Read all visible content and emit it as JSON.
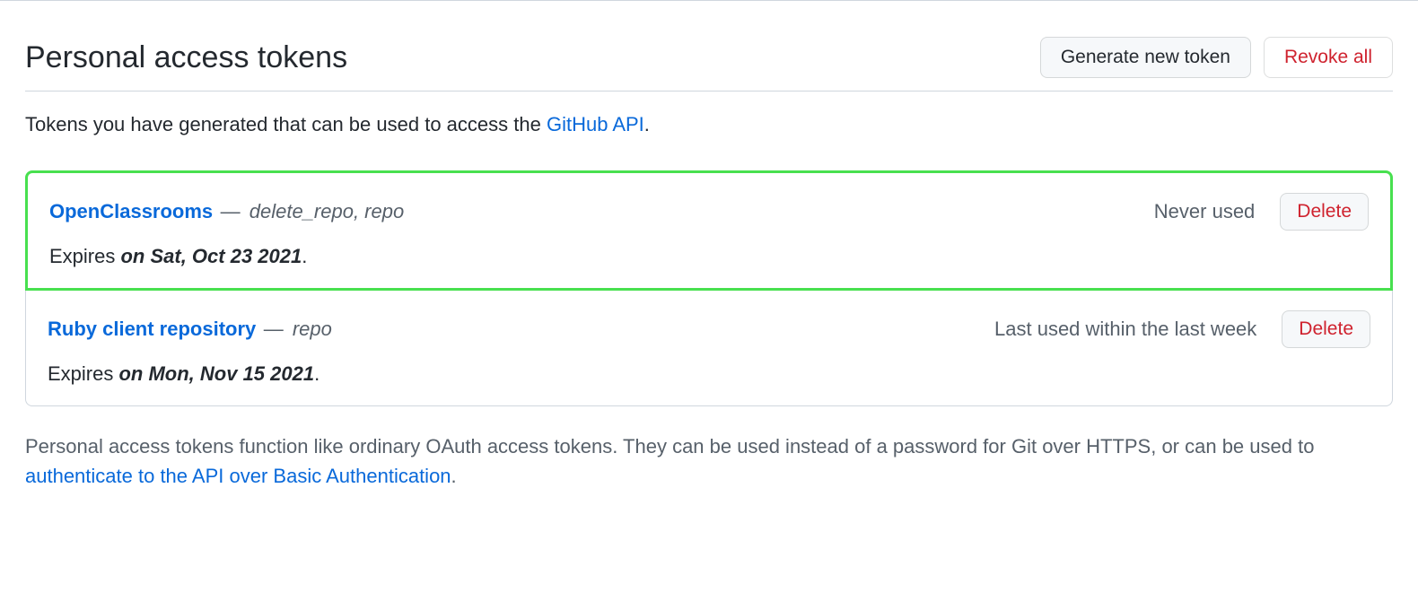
{
  "header": {
    "title": "Personal access tokens",
    "generate_label": "Generate new token",
    "revoke_label": "Revoke all"
  },
  "intro": {
    "text_before": "Tokens you have generated that can be used to access the ",
    "link_text": "GitHub API",
    "text_after": "."
  },
  "tokens": [
    {
      "name": "OpenClassrooms",
      "scopes": "delete_repo, repo",
      "status": "Never used",
      "delete_label": "Delete",
      "expiry_prefix": "Expires ",
      "expiry_date": "on Sat, Oct 23 2021",
      "expiry_suffix": ".",
      "highlighted": true
    },
    {
      "name": "Ruby client repository",
      "scopes": "repo",
      "status": "Last used within the last week",
      "delete_label": "Delete",
      "expiry_prefix": "Expires ",
      "expiry_date": "on Mon, Nov 15 2021",
      "expiry_suffix": ".",
      "highlighted": false
    }
  ],
  "footer": {
    "text_before": "Personal access tokens function like ordinary OAuth access tokens. They can be used instead of a password for Git over HTTPS, or can be used to ",
    "link_text": "authenticate to the API over Basic Authentication",
    "text_after": "."
  }
}
